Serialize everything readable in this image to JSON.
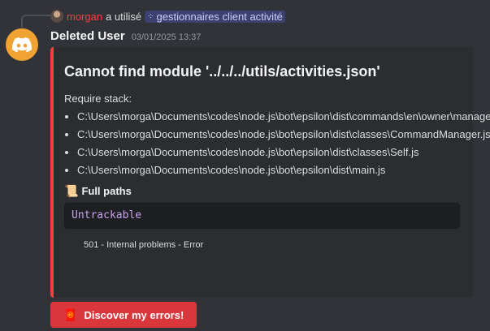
{
  "reply": {
    "user": "morgan",
    "used_text": "a utilisé",
    "command": "gestionnaires client activité"
  },
  "message": {
    "author": "Deleted User",
    "timestamp": "03/01/2025 13:37"
  },
  "embed": {
    "accent_color": "#f23f43",
    "title": "Cannot find module '../../../utils/activities.json'",
    "description": "Require stack:",
    "stack": [
      "C:\\Users\\morga\\Documents\\codes\\node.js\\bot\\epsilon\\dist\\commands\\en\\owner\\managers.js",
      "C:\\Users\\morga\\Documents\\codes\\node.js\\bot\\epsilon\\dist\\classes\\CommandManager.js",
      "C:\\Users\\morga\\Documents\\codes\\node.js\\bot\\epsilon\\dist\\classes\\Self.js",
      "C:\\Users\\morga\\Documents\\codes\\node.js\\bot\\epsilon\\dist\\main.js"
    ],
    "field_icon": "scroll-icon",
    "field_name": "Full paths",
    "field_value": "Untrackable",
    "footer": "501 - Internal problems - Error"
  },
  "button": {
    "label": "Discover my errors!",
    "icon": "red-envelope-icon",
    "color": "#da373c"
  },
  "colors": {
    "background": "#313338",
    "avatar": "#f0a232",
    "username_reply": "#f23f43"
  }
}
